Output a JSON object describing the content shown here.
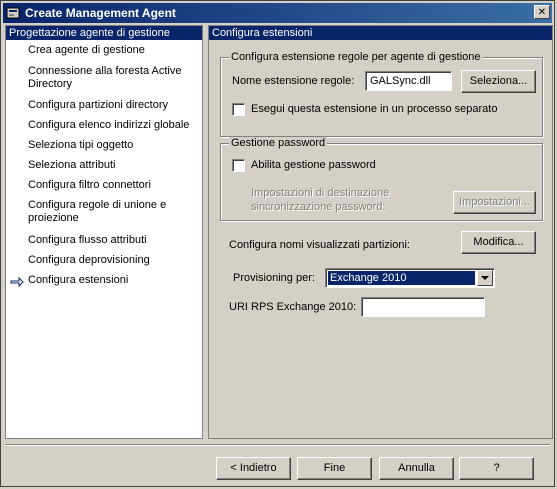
{
  "window": {
    "title": "Create Management Agent",
    "close_glyph": "✕"
  },
  "left_pane": {
    "header": "Progettazione agente di gestione",
    "items": [
      "Crea agente di gestione",
      "Connessione alla foresta Active Directory",
      "Configura partizioni directory",
      "Configura elenco indirizzi globale",
      "Seleziona tipi oggetto",
      "Seleziona attributi",
      "Configura filtro connettori",
      "Configura regole di unione e proiezione",
      "Configura flusso attributi",
      "Configura deprovisioning",
      "Configura estensioni"
    ],
    "current_index": 10
  },
  "right_pane": {
    "header": "Configura estensioni",
    "rules_group": {
      "title": "Configura estensione regole per agente di gestione",
      "name_label": "Nome estensione regole:",
      "name_value": "GALSync.dll",
      "browse_button": "Seleziona...",
      "separate_process_label": "Esegui questa estensione in un processo separato",
      "separate_process_checked": false
    },
    "password_group": {
      "title": "Gestione password",
      "enable_label": "Abilita gestione password",
      "enable_checked": false,
      "target_settings_label_line1": "Impostazioni di destinazione",
      "target_settings_label_line2": "sincronizzazione password:",
      "settings_button": "Impostazioni..."
    },
    "partitions_label": "Configura nomi visualizzati partizioni:",
    "modify_button": "Modifica...",
    "provisioning_label": "Provisioning per:",
    "provisioning_value": "Exchange 2010",
    "uri_label": "URI RPS Exchange 2010:",
    "uri_value": ""
  },
  "footer": {
    "back_button": "< Indietro",
    "finish_button": "Fine",
    "cancel_button": "Annulla",
    "help_button": "?"
  }
}
